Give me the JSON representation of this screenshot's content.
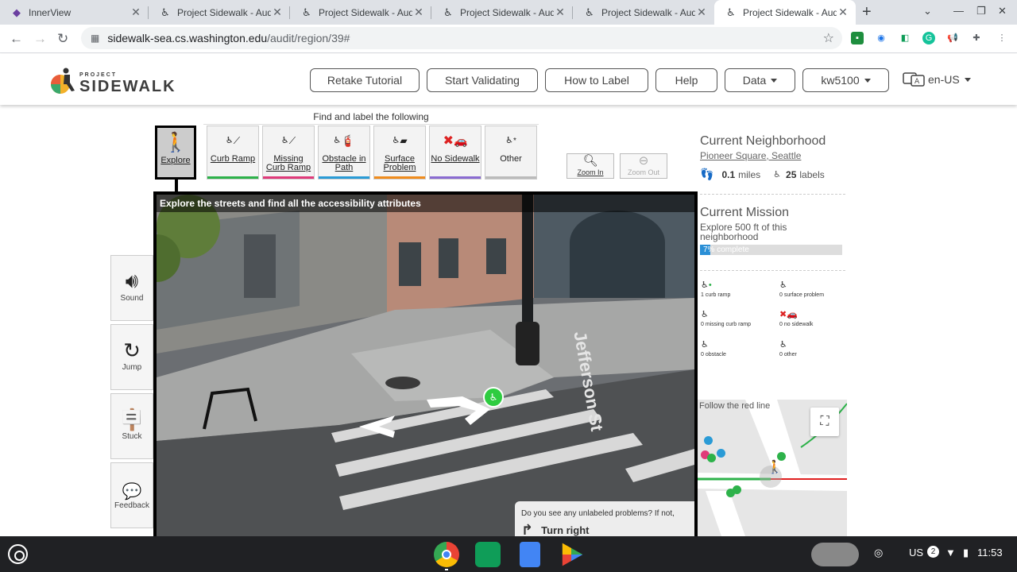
{
  "browser": {
    "tabs": [
      {
        "title": "InnerView",
        "icon": "innerview-icon"
      },
      {
        "title": "Project Sidewalk - Audit",
        "icon": "sidewalk-icon"
      },
      {
        "title": "Project Sidewalk - Audit",
        "icon": "sidewalk-icon"
      },
      {
        "title": "Project Sidewalk - Audit",
        "icon": "sidewalk-icon"
      },
      {
        "title": "Project Sidewalk - Audit",
        "icon": "sidewalk-icon"
      },
      {
        "title": "Project Sidewalk - Audi",
        "icon": "sidewalk-icon"
      }
    ],
    "url_host": "sidewalk-sea.cs.washington.edu",
    "url_path": "/audit/region/39#"
  },
  "header": {
    "logo_small": "PROJECT",
    "logo_big": "SIDEWALK",
    "buttons": {
      "retake": "Retake Tutorial",
      "validate": "Start Validating",
      "howto": "How to Label",
      "help": "Help",
      "data": "Data",
      "user": "kw5100"
    },
    "language": "en-US"
  },
  "toolbar": {
    "heading": "Find and label the following",
    "explore": "Explore",
    "curb_ramp": "Curb Ramp",
    "missing_1": "Missing",
    "missing_2": "Curb Ramp",
    "obstacle_1": "Obstacle in",
    "obstacle_2": "Path",
    "surface_1": "Surface",
    "surface_2": "Problem",
    "no_sidewalk": "No Sidewalk",
    "other": "Other",
    "zoom_in": "Zoom In",
    "zoom_out": "Zoom Out",
    "colors": {
      "curb_ramp": "#2db24a",
      "missing": "#e03a7a",
      "obstacle": "#2a9bd6",
      "surface": "#f08c1d",
      "no_sidewalk": "#8a6bd1",
      "other": "#bbbbbb"
    }
  },
  "pano": {
    "title": "Explore the streets and find all the accessibility attributes",
    "street_sign": "Jefferson St",
    "prompt": "Do you see any unlabeled problems? If not,",
    "action": "Turn right"
  },
  "side": {
    "sound": "Sound",
    "jump": "Jump",
    "stuck": "Stuck",
    "feedback": "Feedback"
  },
  "panel": {
    "neighborhood_head": "Current Neighborhood",
    "neighborhood_name": "Pioneer Square, Seattle",
    "miles_value": "0.1",
    "miles_unit": "miles",
    "labels_value": "25",
    "labels_unit": "labels",
    "mission_head": "Current Mission",
    "mission_line1": "Explore 500 ft of this",
    "mission_line2": "neighborhood",
    "progress_label": "7% complete",
    "progress": 0.07,
    "stats": {
      "curb_ramp": "1 curb ramp",
      "surface": "0 surface problem",
      "missing": "0 missing curb ramp",
      "no_sidewalk": "0 no sidewalk",
      "obstacle": "0 obstacle",
      "other": "0 other"
    },
    "map_caption": "Follow the red line"
  },
  "shelf": {
    "lang": "US",
    "badge": "2",
    "time": "11:53"
  }
}
